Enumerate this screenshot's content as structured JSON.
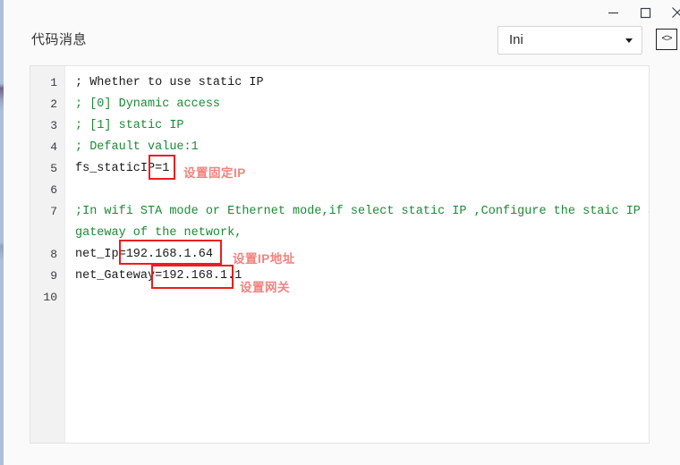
{
  "window": {
    "title": "代码消息",
    "controls": {
      "minimize": "minimize-icon",
      "maximize": "maximize-icon",
      "close": "close-icon"
    }
  },
  "toolbar": {
    "language_select": {
      "value": "Ini",
      "options": [
        "Ini"
      ]
    },
    "code_toggle": {
      "glyph": "<>",
      "icon": "code-brackets-icon"
    }
  },
  "editor": {
    "line_numbers": [
      "1",
      "2",
      "3",
      "4",
      "5",
      "6",
      "7",
      "8",
      "9",
      "10"
    ],
    "lines": [
      {
        "n": "1",
        "text": "; Whether to use static IP",
        "style": "plain"
      },
      {
        "n": "2",
        "text": "; [0] Dynamic access",
        "style": "comment"
      },
      {
        "n": "3",
        "text": "; [1] static IP",
        "style": "comment"
      },
      {
        "n": "4",
        "text": "; Default value:1",
        "style": "comment"
      },
      {
        "n": "5",
        "text": "fs_staticIP=1",
        "style": "plain"
      },
      {
        "n": "6",
        "text": "",
        "style": "plain"
      },
      {
        "n": "7",
        "text": ";In wifi STA mode or Ethernet mode,if select static IP ,Configure the staic IP and",
        "style": "comment"
      },
      {
        "n": "",
        "text": "gateway of the network,",
        "style": "comment"
      },
      {
        "n": "8",
        "text": "net_Ip=192.168.1.64",
        "style": "plain"
      },
      {
        "n": "9",
        "text": "net_Gateway=192.168.1.1",
        "style": "plain"
      },
      {
        "n": "10",
        "text": "",
        "style": "plain"
      }
    ]
  },
  "annotations": [
    {
      "label": "设置固定IP",
      "value": "1"
    },
    {
      "label": "设置IP地址",
      "value": "192.168.1.64"
    },
    {
      "label": "设置网关",
      "value": "192.168.1.1"
    }
  ],
  "colors": {
    "comment_green": "#1d8a36",
    "annotation_red": "#ee1c1c",
    "annotation_label": "#f2837f",
    "editor_bg": "#ffffff",
    "gutter_bg": "#f2f2f2",
    "window_bg": "#fafafa"
  }
}
